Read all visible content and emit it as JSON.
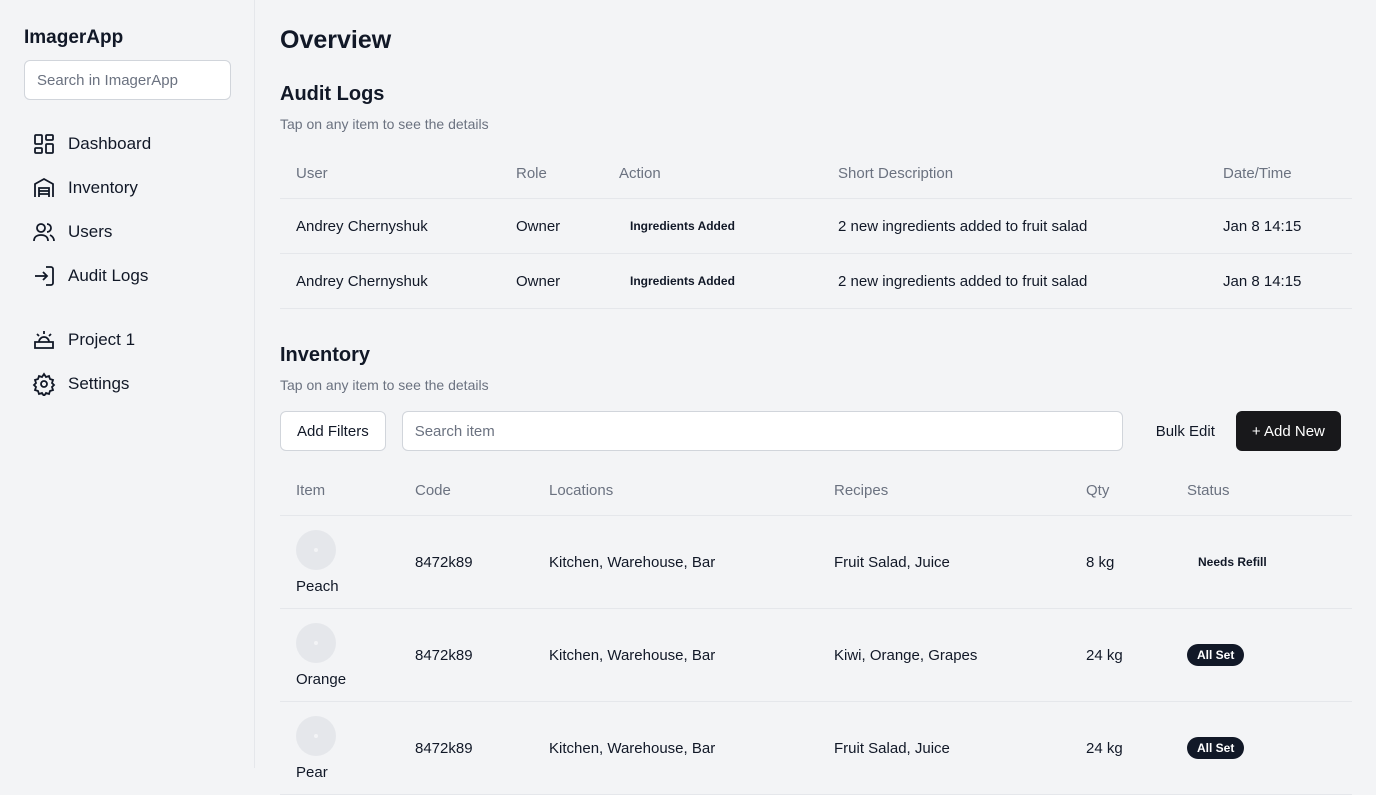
{
  "app": {
    "name": "ImagerApp",
    "search_placeholder": "Search in ImagerApp"
  },
  "sidebar": {
    "items": [
      {
        "label": "Dashboard",
        "icon": "dashboard-icon"
      },
      {
        "label": "Inventory",
        "icon": "warehouse-icon"
      },
      {
        "label": "Users",
        "icon": "users-icon"
      },
      {
        "label": "Audit Logs",
        "icon": "login-icon"
      },
      {
        "label": "Project 1",
        "icon": "project-icon"
      },
      {
        "label": "Settings",
        "icon": "gear-icon"
      }
    ]
  },
  "page": {
    "title": "Overview"
  },
  "audit": {
    "title": "Audit Logs",
    "subtitle": "Tap on any item to see the details",
    "columns": [
      "User",
      "Role",
      "Action",
      "Short Description",
      "Date/Time"
    ],
    "rows": [
      {
        "user": "Andrey Chernyshuk",
        "role": "Owner",
        "action": "Ingredients Added",
        "description": "2 new ingredients added to fruit salad",
        "datetime": "Jan 8 14:15"
      },
      {
        "user": "Andrey Chernyshuk",
        "role": "Owner",
        "action": "Ingredients Added",
        "description": "2 new ingredients added to fruit salad",
        "datetime": "Jan 8 14:15"
      }
    ]
  },
  "inventory": {
    "title": "Inventory",
    "subtitle": "Tap on any item to see the details",
    "add_filters": "Add Filters",
    "search_placeholder": "Search item",
    "bulk_edit": "Bulk Edit",
    "add_new": "+ Add New",
    "columns": [
      "Item",
      "Code",
      "Locations",
      "Recipes",
      "Qty",
      "Status"
    ],
    "rows": [
      {
        "item": "Peach",
        "code": "8472k89",
        "locations": "Kitchen, Warehouse, Bar",
        "recipes": "Fruit Salad, Juice",
        "qty": "8 kg",
        "status": "Needs Refill"
      },
      {
        "item": "Orange",
        "code": "8472k89",
        "locations": "Kitchen, Warehouse, Bar",
        "recipes": "Kiwi, Orange, Grapes",
        "qty": "24 kg",
        "status": "All Set"
      },
      {
        "item": "Pear",
        "code": "8472k89",
        "locations": "Kitchen, Warehouse, Bar",
        "recipes": "Fruit Salad, Juice",
        "qty": "24 kg",
        "status": "All Set"
      }
    ]
  }
}
